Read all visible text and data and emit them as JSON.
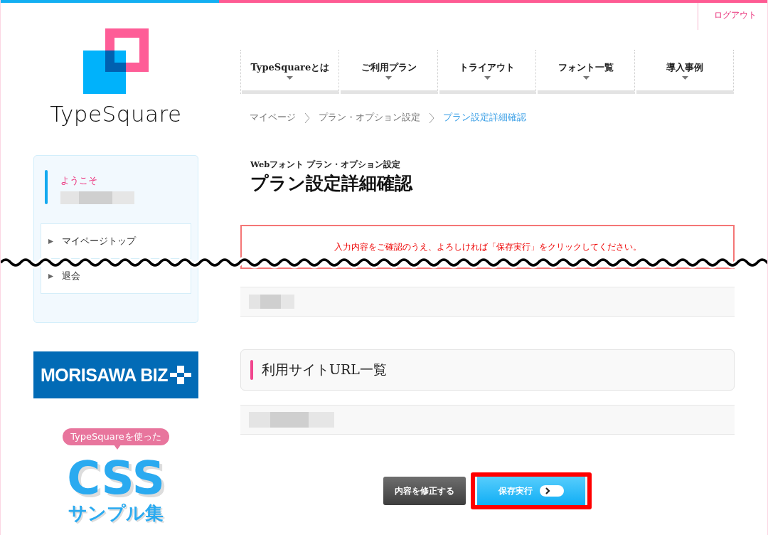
{
  "header": {
    "logout": "ログアウト"
  },
  "logo": {
    "name": "TypeSquare"
  },
  "sidebar": {
    "welcome": "ようこそ",
    "menu": [
      {
        "label": "マイページトップ"
      },
      {
        "label": "退会"
      }
    ]
  },
  "banners": {
    "biz": "MORISAWA BIZ",
    "css_sample": {
      "bubble": "TypeSquareを使った",
      "title": "CSS",
      "subtitle": "サンプル集"
    }
  },
  "nav": [
    {
      "label": "TypeSquareとは"
    },
    {
      "label": "ご利用プラン"
    },
    {
      "label": "トライアウト"
    },
    {
      "label": "フォント一覧"
    },
    {
      "label": "導入事例"
    }
  ],
  "breadcrumb": [
    {
      "label": "マイページ",
      "current": false
    },
    {
      "label": "プラン・オプション設定",
      "current": false
    },
    {
      "label": "プラン設定詳細確認",
      "current": true
    }
  ],
  "page": {
    "subtitle": "Webフォント プラン・オプション設定",
    "title": "プラン設定詳細確認"
  },
  "alert": "入力内容をご確認のうえ、よろしければ「保存実行」をクリックしてください。",
  "section": {
    "heading": "利用サイトURL一覧"
  },
  "buttons": [
    {
      "label": "内容を修正する",
      "kind": "secondary",
      "highlighted": false
    },
    {
      "label": "保存実行",
      "kind": "primary",
      "highlighted": true
    }
  ]
}
